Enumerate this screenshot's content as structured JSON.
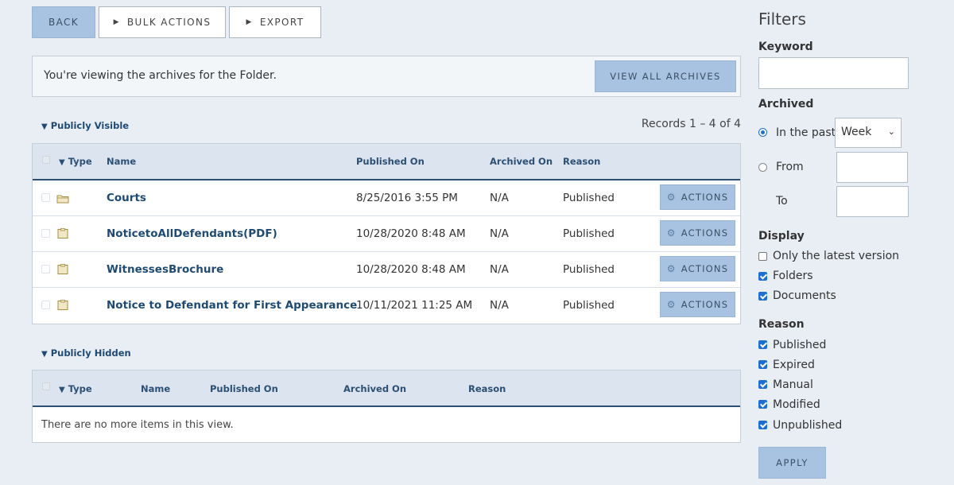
{
  "toolbar": {
    "back_label": "BACK",
    "bulk_actions_label": "BULK ACTIONS",
    "export_label": "EXPORT"
  },
  "notice": {
    "text": "You're viewing the archives for the Folder.",
    "view_all_label": "VIEW ALL ARCHIVES"
  },
  "visible_section": {
    "title": "Publicly Visible",
    "records": "Records 1 – 4 of 4",
    "columns": {
      "type": "Type",
      "name": "Name",
      "published_on": "Published On",
      "archived_on": "Archived On",
      "reason": "Reason"
    },
    "rows": [
      {
        "icon": "folder-icon",
        "name": "Courts",
        "published_on": "8/25/2016 3:55 PM",
        "archived_on": "N/A",
        "reason": "Published",
        "action_label": "ACTIONS"
      },
      {
        "icon": "document-icon",
        "name": "NoticetoAllDefendants(PDF)",
        "published_on": "10/28/2020 8:48 AM",
        "archived_on": "N/A",
        "reason": "Published",
        "action_label": "ACTIONS"
      },
      {
        "icon": "document-icon",
        "name": "WitnessesBrochure",
        "published_on": "10/28/2020 8:48 AM",
        "archived_on": "N/A",
        "reason": "Published",
        "action_label": "ACTIONS"
      },
      {
        "icon": "document-icon",
        "name": "Notice to Defendant for First Appearance",
        "published_on": "10/11/2021 11:25 AM",
        "archived_on": "N/A",
        "reason": "Published",
        "action_label": "ACTIONS"
      }
    ]
  },
  "hidden_section": {
    "title": "Publicly Hidden",
    "columns": {
      "type": "Type",
      "name": "Name",
      "published_on": "Published On",
      "archived_on": "Archived On",
      "reason": "Reason"
    },
    "empty_text": "There are no more items in this view."
  },
  "filters": {
    "title": "Filters",
    "keyword_label": "Keyword",
    "keyword_value": "",
    "archived_label": "Archived",
    "in_the_past_label": "In the past",
    "period_value": "Week",
    "from_label": "From",
    "to_label": "To",
    "display_label": "Display",
    "display_options": [
      {
        "label": "Only the latest version",
        "checked": false
      },
      {
        "label": "Folders",
        "checked": true
      },
      {
        "label": "Documents",
        "checked": true
      }
    ],
    "reason_label": "Reason",
    "reason_options": [
      {
        "label": "Published",
        "checked": true
      },
      {
        "label": "Expired",
        "checked": true
      },
      {
        "label": "Manual",
        "checked": true
      },
      {
        "label": "Modified",
        "checked": true
      },
      {
        "label": "Unpublished",
        "checked": true
      }
    ],
    "apply_label": "APPLY"
  },
  "colors": {
    "background": "#e9eef4",
    "button_blue": "#a8c3e1",
    "link": "#1e4a73",
    "header_rule": "#2c4f74",
    "checkbox_blue": "#1d6fd6"
  }
}
